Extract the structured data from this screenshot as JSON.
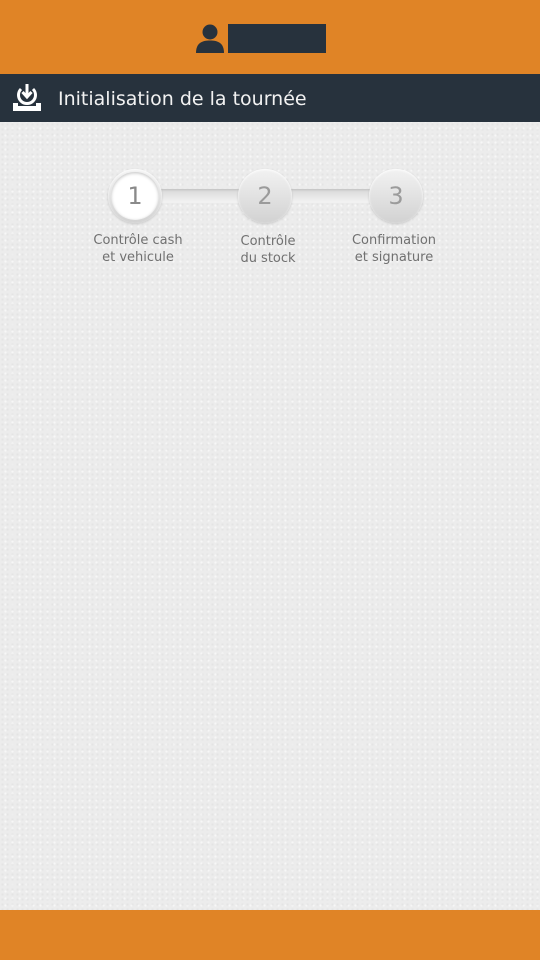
{
  "header": {
    "user_icon": "user-icon",
    "user_name": ""
  },
  "title_bar": {
    "icon": "download-tray-icon",
    "title": "Initialisation de la tournée"
  },
  "stepper": {
    "active_step": 1,
    "steps": [
      {
        "number": "1",
        "label_line1": "Contrôle cash",
        "label_line2": "et vehicule"
      },
      {
        "number": "2",
        "label_line1": "Contrôle",
        "label_line2": "du stock"
      },
      {
        "number": "3",
        "label_line1": "Confirmation",
        "label_line2": "et signature"
      }
    ]
  },
  "colors": {
    "accent_orange": "#e08426",
    "header_dark": "#27323d",
    "background": "#ececec"
  }
}
